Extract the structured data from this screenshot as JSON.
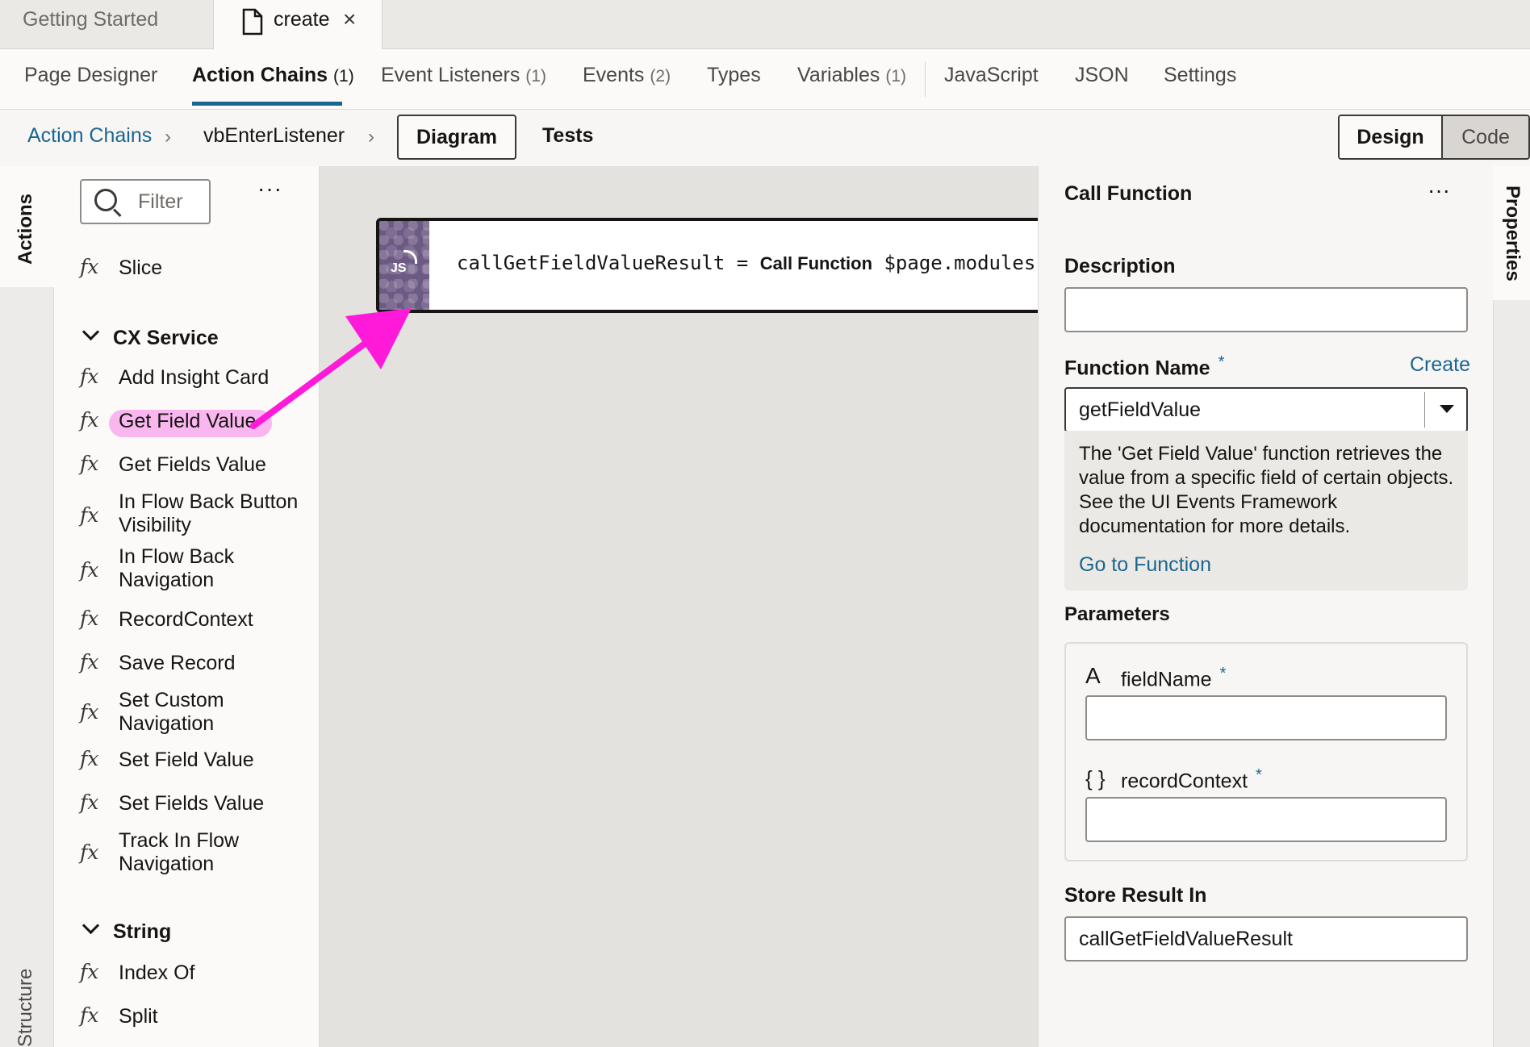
{
  "file_tabs": [
    {
      "label": "Getting Started"
    },
    {
      "label": "create",
      "close": "×"
    }
  ],
  "designer_tabs": [
    {
      "label": "Page Designer",
      "count": ""
    },
    {
      "label": "Action Chains",
      "count": "(1)"
    },
    {
      "label": "Event Listeners",
      "count": "(1)"
    },
    {
      "label": "Events",
      "count": "(2)"
    },
    {
      "label": "Types",
      "count": ""
    },
    {
      "label": "Variables",
      "count": "(1)"
    },
    {
      "label": "JavaScript",
      "count": ""
    },
    {
      "label": "JSON",
      "count": ""
    },
    {
      "label": "Settings",
      "count": ""
    }
  ],
  "breadcrumb": {
    "root": "Action Chains",
    "current": "vbEnterListener",
    "diagram": "Diagram",
    "tests": "Tests",
    "design": "Design",
    "code": "Code"
  },
  "rails": {
    "actions": "Actions",
    "structure": "Structure",
    "properties": "Properties"
  },
  "palette": {
    "filter_placeholder": "Filter",
    "more": "···",
    "fx": "fx",
    "slice": "Slice",
    "groups": [
      {
        "name": "CX Service",
        "items": [
          "Add Insight Card",
          "Get Field Value",
          "Get Fields Value",
          "In Flow Back Button Visibility",
          "In Flow Back Navigation",
          "RecordContext",
          "Save Record",
          "Set Custom Navigation",
          "Set Field Value",
          "Set Fields Value",
          "Track In Flow Navigation"
        ]
      },
      {
        "name": "String",
        "items": [
          "Index Of",
          "Split"
        ]
      }
    ],
    "highlight_color": "#f9b6ef"
  },
  "canvas": {
    "node_badge": "JS",
    "node_result": "callGetFieldValueResult",
    "node_op": "=",
    "node_action": "Call Function",
    "node_target": "$page.modules",
    "arrow_color": "#ff1ad9"
  },
  "properties": {
    "title": "Call Function",
    "more": "···",
    "description_label": "Description",
    "description_value": "",
    "function_name_label": "Function Name",
    "required_mark": "*",
    "create_link": "Create",
    "function_name_value": "getFieldValue",
    "function_info": "The 'Get Field Value' function retrieves the value from a specific field of certain objects. See the UI Events Framework documentation for more details.",
    "go_to_function": "Go to Function",
    "parameters_label": "Parameters",
    "params": [
      {
        "icon": "A",
        "name": "fieldName",
        "value": ""
      },
      {
        "icon": "{ }",
        "name": "recordContext",
        "value": ""
      }
    ],
    "store_result_label": "Store Result In",
    "store_result_value": "callGetFieldValueResult"
  },
  "colors": {
    "link": "#1b6690",
    "js_badge": "#6d5a84"
  }
}
